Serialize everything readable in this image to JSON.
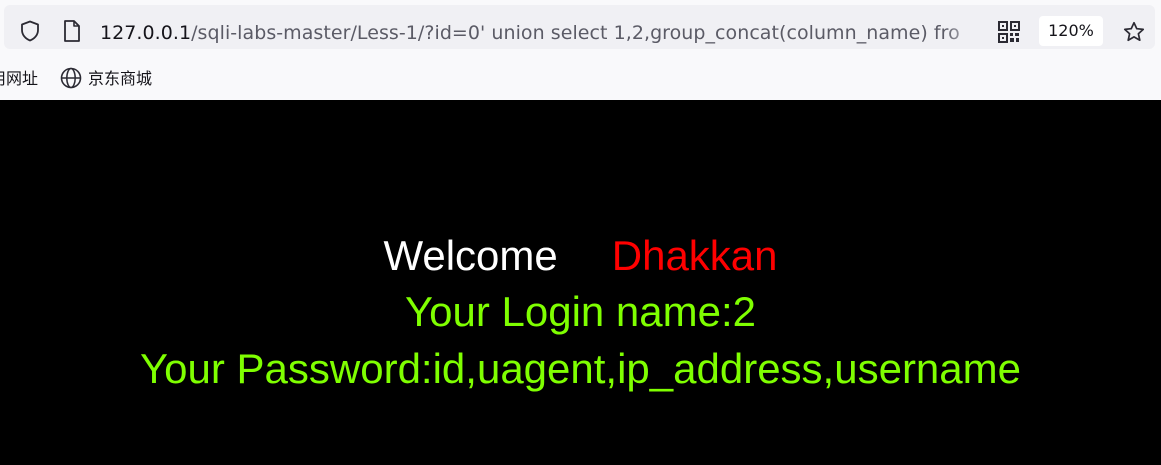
{
  "browser": {
    "url_host": "127.0.0.1",
    "url_rest": "/sqli-labs-master/Less-1/?id=0' union select 1,2,group_concat(column_name) fro",
    "zoom_label": "120%",
    "icons": {
      "tracking_protection": "shield-icon",
      "page_info": "page-icon",
      "qr_code": "qr-code-icon",
      "bookmark": "star-icon",
      "bookmark_favicon": "globe-icon"
    }
  },
  "bookmarks": [
    {
      "label": "用网址"
    },
    {
      "label": "京东商城"
    }
  ],
  "page": {
    "welcome_label": "Welcome",
    "welcome_name": "Dhakkan",
    "login_line": "Your Login name:2",
    "password_line": "Your Password:id,uagent,ip_address,username"
  },
  "colors": {
    "page_background": "#000000",
    "welcome_text": "#ffffff",
    "name_text": "#ff0000",
    "result_text": "#7fff00"
  }
}
